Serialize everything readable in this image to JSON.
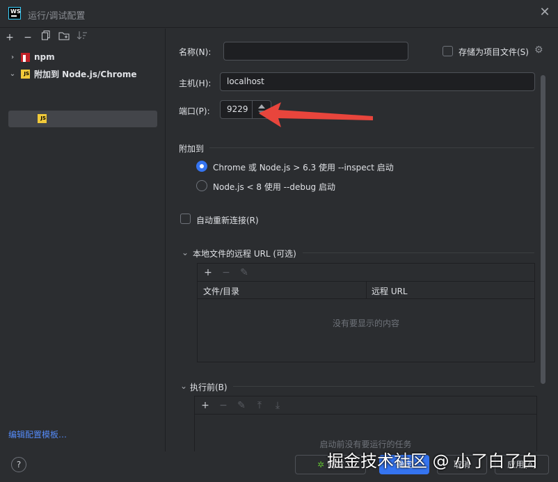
{
  "window": {
    "title": "运行/调试配置",
    "logo_text": "WS"
  },
  "left_toolbar": [
    "+",
    "−",
    "⧉",
    "📁",
    "↓≡"
  ],
  "tree": {
    "npm_label": "npm",
    "attach_label": "附加到 Node.js/Chrome",
    "child_icon": "js-icon"
  },
  "edit_templates_link": "编辑配置模板…",
  "form": {
    "name_label": "名称(N):",
    "name_value": "",
    "store_as_project_label": "存储为项目文件(S)",
    "host_label": "主机(H):",
    "host_value": "localhost",
    "port_label": "端口(P):",
    "port_value": "9229",
    "attach_to_label": "附加到",
    "radio_option_1": "Chrome 或 Node.js > 6.3 使用 --inspect 启动",
    "radio_option_2": "Node.js < 8 使用 --debug 启动",
    "auto_reconnect_label": "自动重新连接(R)",
    "remote_url_section": "本地文件的远程 URL (可选)",
    "remote_url_col1": "文件/目录",
    "remote_url_col2": "远程 URL",
    "remote_url_empty": "没有要显示的内容",
    "before_launch_section": "执行前(B)",
    "before_launch_empty": "启动前没有要运行的任务"
  },
  "buttons": {
    "debug": "调试",
    "ok": "确定",
    "cancel": "取消",
    "apply": "应用(A)",
    "help": "?"
  },
  "watermark": "掘金技术社区 @ 小了白了白",
  "colors": {
    "accent": "#3574f0",
    "arrow": "#e8453c",
    "link": "#548af7"
  }
}
